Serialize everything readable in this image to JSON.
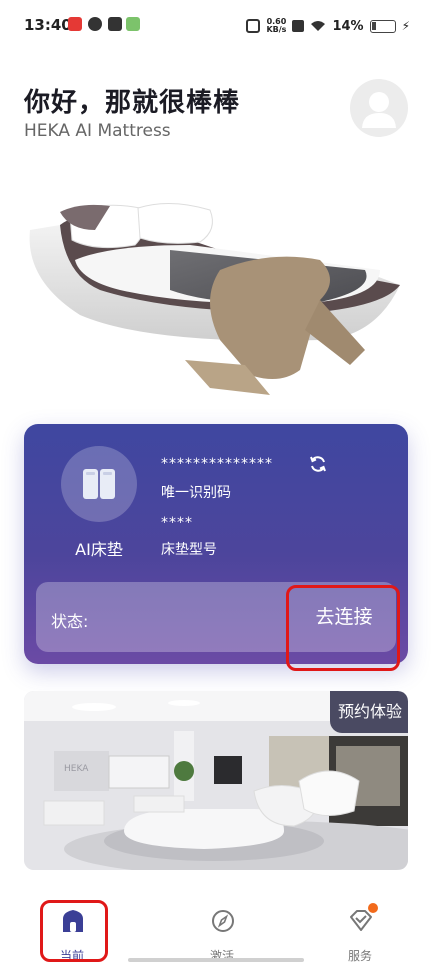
{
  "status_bar": {
    "time": "13:40",
    "net_speed_value": "0.60",
    "net_speed_unit": "KB/s",
    "battery": "14%"
  },
  "header": {
    "greeting": "你好，那就很棒棒",
    "subtitle": "HEKA AI Mattress",
    "avatar_icon": "user-avatar-icon"
  },
  "device_card": {
    "device_name": "AI床垫",
    "id_value": "**************",
    "id_label": "唯一识别码",
    "model_value": "****",
    "model_label": "床垫型号",
    "status_label": "状态:",
    "connect_label": "去连接",
    "icons": [
      "mattress-icon",
      "refresh-icon"
    ]
  },
  "showroom": {
    "booking_label": "预约体验",
    "brand_sign": "HEKA"
  },
  "bottom_nav": {
    "items": [
      {
        "label": "当前",
        "icon": "home-icon",
        "active": true
      },
      {
        "label": "激活",
        "icon": "compass-icon",
        "active": false
      },
      {
        "label": "服务",
        "icon": "service-heart-icon",
        "active": false,
        "badge": true
      }
    ]
  },
  "colors": {
    "card_top": "#3f47a0",
    "card_bottom": "#6b4aa5",
    "nav_active": "#3b3f96",
    "highlight": "#e01818",
    "badge": "#f26a1b",
    "booking_tag": "#4a4a62"
  }
}
